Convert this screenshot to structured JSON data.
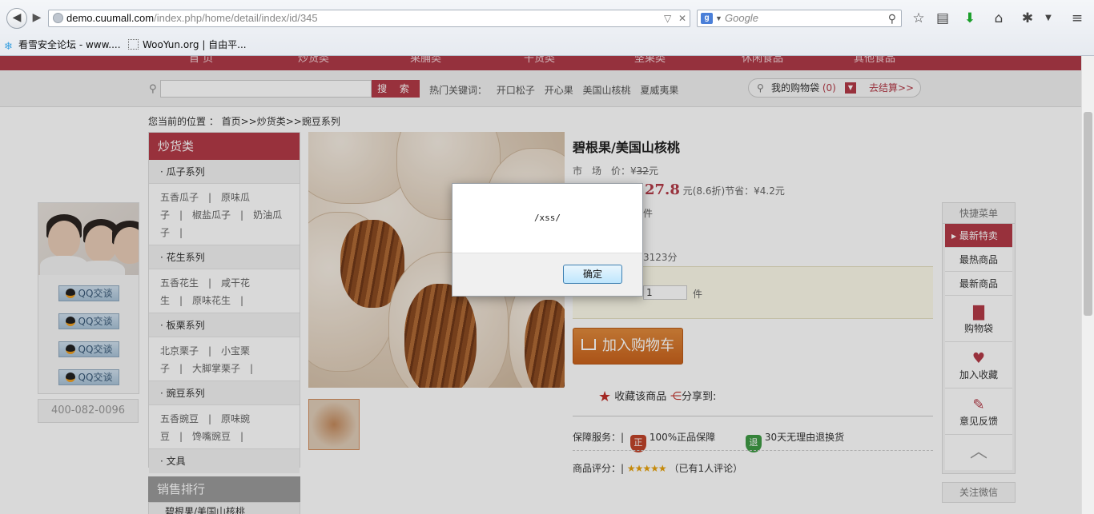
{
  "browser": {
    "url_host": "demo.cuumall.com",
    "url_path": "/index.php/home/detail/index/id/345",
    "search_engine": "g",
    "search_placeholder": "Google",
    "bookmarks": [
      "看雪安全论坛 - www....",
      "WooYun.org | 自由平..."
    ]
  },
  "site": {
    "nav": [
      "首 页",
      "炒货类",
      "果脯类",
      "干货类",
      "坚果类",
      "休闲食品",
      "其他食品"
    ],
    "search_button": "搜 索",
    "hot_label": "热门关键词：",
    "hot_keywords": [
      "开口松子",
      "开心果",
      "美国山核桃",
      "夏威夷果"
    ],
    "cart_label": "我的购物袋",
    "cart_count": "(0)",
    "checkout": "去结算>>",
    "breadcrumb": "您当前的位置 ： 首页>>炒货类>>豌豆系列"
  },
  "sidebar": {
    "title": "炒货类",
    "groups": [
      {
        "head": "· 瓜子系列",
        "lines": [
          "五香瓜子　|　原味瓜",
          "子　|　椒盐瓜子　|　奶油瓜",
          "子　|"
        ]
      },
      {
        "head": "· 花生系列",
        "lines": [
          "五香花生　|　咸干花",
          "生　|　原味花生　|"
        ]
      },
      {
        "head": "· 板栗系列",
        "lines": [
          "北京栗子　|　小宝栗",
          "子　|　大脚掌栗子　|"
        ]
      },
      {
        "head": "· 豌豆系列",
        "lines": [
          "五香豌豆　|　原味豌",
          "豆　|　馋嘴豌豆　|"
        ]
      },
      {
        "head": "· 文具",
        "lines": []
      }
    ],
    "sales_title": "销售排行",
    "sales_first": "碧根果/美国山核桃"
  },
  "service": {
    "qq_buttons": [
      "QQ交谈",
      "QQ交谈",
      "QQ交谈",
      "QQ交谈"
    ],
    "phone": "400-082-0096"
  },
  "product": {
    "name": "碧根果/美国山核桃",
    "market_label": "市　场　价：",
    "market_currency": "¥",
    "market_price": "32",
    "market_unit": "元",
    "price": "27.8",
    "price_suffix": "元",
    "discount": "(8.6折)",
    "save_label": "节省：",
    "save_value": "¥4.2元",
    "meta1": "件",
    "meta2": "3123分",
    "quantity": "1",
    "quantity_unit": "件",
    "add_to_cart": "加入购物车",
    "favorite": "收藏该商品",
    "share": "分享到:",
    "guarantee_label": "保障服务：|",
    "guarantee_1_icon": "正",
    "guarantee_1": "100%正品保障",
    "guarantee_2_icon": "退",
    "guarantee_2": "30天无理由退换货",
    "rating_label": "商品评分：|",
    "rating_stars": 5,
    "rating_text": "（已有1人评论）"
  },
  "quick_menu": {
    "title": "快捷菜单",
    "items": [
      "最新特卖",
      "最热商品",
      "最新商品"
    ],
    "icons": [
      {
        "label": "购物袋",
        "icon": "bag-icon"
      },
      {
        "label": "加入收藏",
        "icon": "heart-icon"
      },
      {
        "label": "意见反馈",
        "icon": "feedback-icon"
      }
    ],
    "follow": "关注微信"
  },
  "dialog": {
    "message": "/xss/",
    "ok": "确定"
  },
  "colors": {
    "brand": "#b33a47",
    "cart_button": "#d2702a",
    "rating_star": "#e8a20c"
  }
}
